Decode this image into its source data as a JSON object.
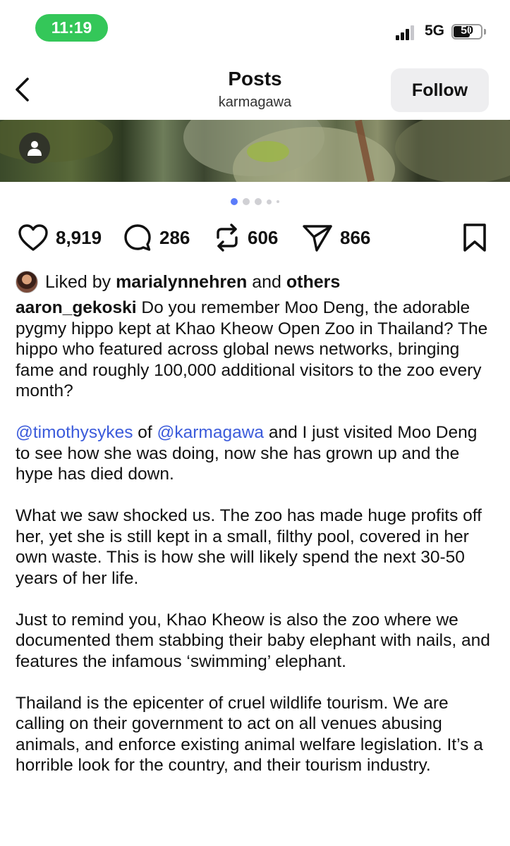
{
  "status_bar": {
    "time": "11:19",
    "network": "5G",
    "battery": "50",
    "accent_color": "#34c759"
  },
  "header": {
    "title": "Posts",
    "subtitle": "karmagawa",
    "follow_label": "Follow",
    "back_icon": "chevron-left-icon"
  },
  "carousel": {
    "total": 5,
    "active_index": 0,
    "active_color": "#5b7cfa"
  },
  "actions": {
    "likes": "8,919",
    "comments": "286",
    "reposts": "606",
    "shares": "866",
    "icons": [
      "heart-icon",
      "comment-icon",
      "repost-icon",
      "send-icon",
      "bookmark-icon"
    ]
  },
  "liked_by": {
    "prefix": "Liked by ",
    "user": "marialynnehren",
    "middle": " and ",
    "others": "others"
  },
  "caption": {
    "author": "aaron_gekoski",
    "p1": " Do you remember Moo Deng, the adorable pygmy hippo kept at Khao Kheow Open Zoo in Thailand? The hippo who featured across global news networks, bringing fame and roughly 100,000 additional visitors to the zoo every month?",
    "mention1": "@timothysykes",
    "of_text": " of ",
    "mention2": "@karmagawa",
    "p2": " and I just visited Moo Deng to see how she was doing, now she has grown up and the hype has died down.",
    "p3": "What we saw shocked us. The zoo has made huge profits off her, yet she is still kept in a small, filthy pool, covered in her own waste. This is how she will likely spend the next 30-50 years of her life.",
    "p4": "Just to remind you, Khao Kheow is also the zoo where we documented them stabbing their baby elephant with nails, and features the infamous ‘swimming’ elephant.",
    "p5": "Thailand is the epicenter of cruel wildlife tourism. We are calling on their government to act on all venues abusing animals, and enforce existing animal welfare legislation. It’s a horrible look for the country, and their tourism industry."
  }
}
